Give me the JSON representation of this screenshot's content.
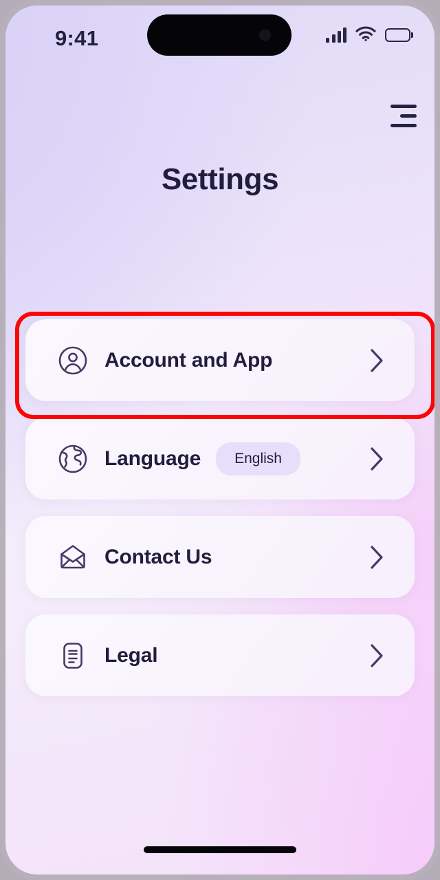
{
  "device": {
    "status_bar": {
      "time": "9:41",
      "signal_icon": "cellular-signal-icon",
      "wifi_icon": "wifi-icon",
      "battery_icon": "battery-full-icon"
    },
    "home_indicator": "home-indicator"
  },
  "header": {
    "title": "Settings",
    "menu_icon": "hamburger-menu-icon"
  },
  "settings": {
    "items": [
      {
        "label": "Account and App",
        "icon": "user-circle-icon",
        "badge": null,
        "chevron": "chevron-right-icon",
        "highlighted": true
      },
      {
        "label": "Language",
        "icon": "globe-icon",
        "badge": "English",
        "chevron": "chevron-right-icon",
        "highlighted": false
      },
      {
        "label": "Contact Us",
        "icon": "open-envelope-icon",
        "badge": null,
        "chevron": "chevron-right-icon",
        "highlighted": false
      },
      {
        "label": "Legal",
        "icon": "document-lines-icon",
        "badge": null,
        "chevron": "chevron-right-icon",
        "highlighted": false
      }
    ]
  },
  "annotation": {
    "highlight_color": "#fc0505",
    "highlight_target": "Account and App"
  },
  "colors": {
    "text_primary": "#221c3e",
    "icon_stroke": "#443a66",
    "badge_background": "#e6dffa",
    "card_background": "#faf7fd",
    "bg_lavender": "#ded7f6",
    "bg_pink": "#f6e2fa",
    "frame": "#b7b0bb"
  }
}
